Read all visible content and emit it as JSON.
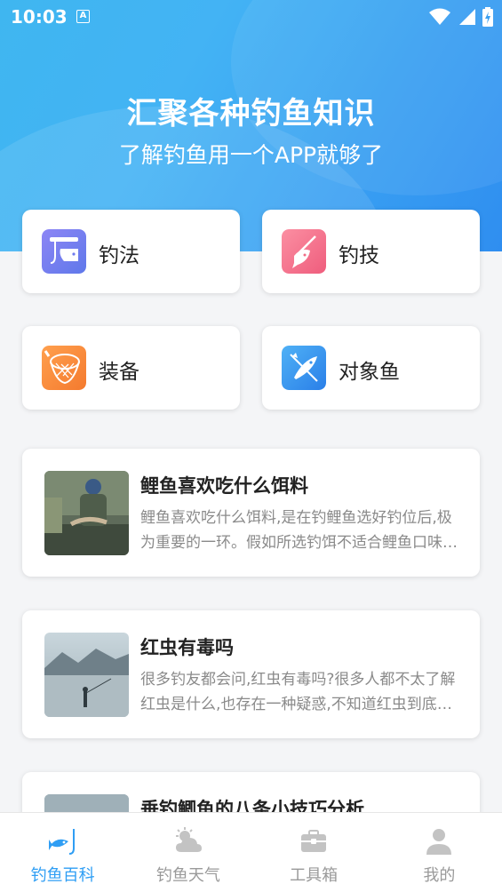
{
  "status": {
    "time": "10:03",
    "notif_icon": "A"
  },
  "hero": {
    "title": "汇聚各种钓鱼知识",
    "subtitle": "了解钓鱼用一个APP就够了"
  },
  "categories": [
    {
      "label": "钓法",
      "icon": "fishing-method-icon",
      "color": "#7d7ff0"
    },
    {
      "label": "钓技",
      "icon": "fishing-skill-icon",
      "color": "#f26f8a"
    },
    {
      "label": "装备",
      "icon": "fishing-net-icon",
      "color": "#f48a3c"
    },
    {
      "label": "对象鱼",
      "icon": "target-fish-icon",
      "color": "#2f8ef0"
    }
  ],
  "articles": [
    {
      "title": "鲤鱼喜欢吃什么饵料",
      "desc": "鲤鱼喜欢吃什么饵料,是在钓鲤鱼选好钓位后,极为重要的一环。假如所选钓饵不适合鲤鱼口味,即便钓位选得再好也难有收获。"
    },
    {
      "title": "红虫有毒吗",
      "desc": "很多钓友都会问,红虫有毒吗?很多人都不太了解红虫是什么,也存在一种疑惑,不知道红虫到底有没有毒。"
    },
    {
      "title": "垂钓鲫鱼的八条小技巧分析",
      "desc": ""
    }
  ],
  "tabs": [
    {
      "label": "钓鱼百科",
      "icon": "fish-rod-icon",
      "active": true
    },
    {
      "label": "钓鱼天气",
      "icon": "weather-icon",
      "active": false
    },
    {
      "label": "工具箱",
      "icon": "toolbox-icon",
      "active": false
    },
    {
      "label": "我的",
      "icon": "profile-icon",
      "active": false
    }
  ],
  "colors": {
    "accent": "#2f9ef4",
    "hero_start": "#3fb6f0",
    "hero_end": "#2f8ef0"
  }
}
